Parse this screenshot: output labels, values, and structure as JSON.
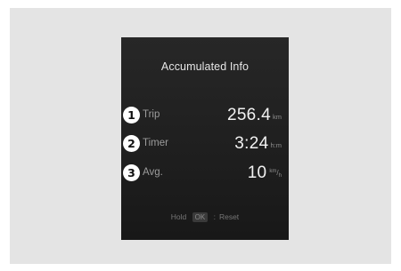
{
  "screen": {
    "title": "Accumulated Info",
    "rows": [
      {
        "badge": "1",
        "label": "Trip",
        "value": "256.4",
        "unit": "km"
      },
      {
        "badge": "2",
        "label": "Timer",
        "value": "3:24",
        "unit": "h:m"
      },
      {
        "badge": "3",
        "label": "Avg.",
        "value": "10",
        "unit_top": "km",
        "unit_bottom": "h"
      }
    ],
    "hint": {
      "prefix": "Hold",
      "button": "OK",
      "separator": ":",
      "action": "Reset"
    }
  },
  "colors": {
    "backdrop": "#e4e4e4",
    "screen": "#222222",
    "value_text": "#f2f2f2",
    "label_text": "#9c9c9c"
  }
}
